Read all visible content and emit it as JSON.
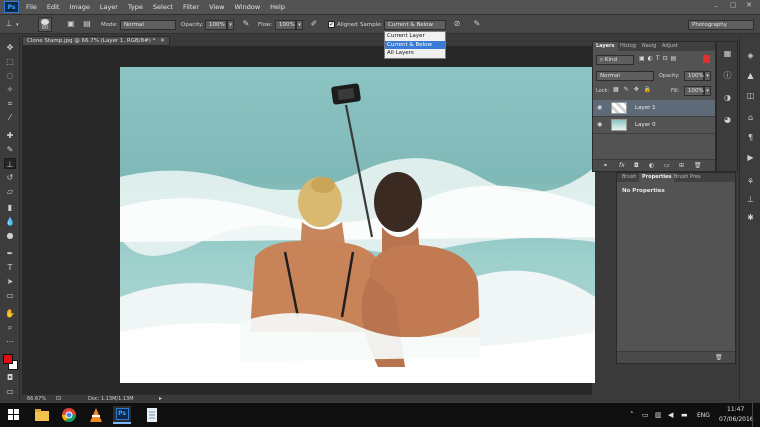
{
  "menubar": {
    "app_logo": "Ps",
    "items": [
      "File",
      "Edit",
      "Image",
      "Layer",
      "Type",
      "Select",
      "Filter",
      "View",
      "Window",
      "Help"
    ]
  },
  "options": {
    "brush_size": "80",
    "mode_label": "Mode:",
    "mode_value": "Normal",
    "opacity_label": "Opacity:",
    "opacity_value": "100%",
    "flow_label": "Flow:",
    "flow_value": "100%",
    "aligned_label": "Aligned",
    "sample_label": "Sample:",
    "sample_value": "Current & Below",
    "workspace_value": "Photography"
  },
  "sample_dropdown": {
    "options": [
      "Current Layer",
      "Current & Below",
      "All Layers"
    ],
    "selected_index": 1
  },
  "document": {
    "tab_title": "Clone Stamp.jpg @ 66.7% (Layer 1, RGB/8#) *",
    "zoom": "66.67%",
    "doc_info": "Doc: 1.13M/1.13M"
  },
  "layers_panel": {
    "tabs": [
      "Layers",
      "Histog",
      "Navig",
      "Adjust"
    ],
    "filter_value": "Kind",
    "blend_mode": "Normal",
    "opacity_label": "Opacity:",
    "opacity_value": "100%",
    "lock_label": "Lock:",
    "fill_label": "Fill:",
    "fill_value": "100%",
    "layers": [
      {
        "name": "Layer 1",
        "selected": true
      },
      {
        "name": "Layer 0",
        "selected": false
      }
    ],
    "footer_fx": "fx"
  },
  "properties_panel": {
    "tabs": [
      "Brush",
      "Properties",
      "Brush Pres"
    ],
    "message": "No Properties"
  },
  "taskbar": {
    "language": "ENG",
    "time": "11:47",
    "date": "07/06/2016",
    "ps_label": "Ps"
  },
  "colors": {
    "foreground": "#e01010",
    "background": "#ffffff",
    "accent": "#3a7bd5"
  }
}
